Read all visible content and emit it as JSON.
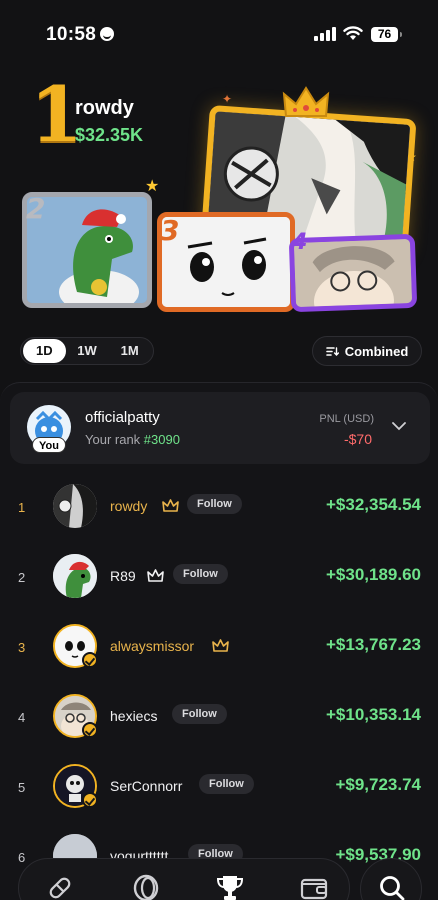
{
  "status_bar": {
    "time": "10:58",
    "battery": "76"
  },
  "hero": {
    "top_rank": "1",
    "top_name": "rowdy",
    "top_amount": "$32.35K",
    "podium": [
      "2",
      "3",
      "4"
    ]
  },
  "filters": {
    "periods": [
      "1D",
      "1W",
      "1M"
    ],
    "active_period": "1D",
    "combined_label": "Combined"
  },
  "you": {
    "name": "officialpatty",
    "rank_label": "Your rank",
    "rank_value": "#3090",
    "badge": "You",
    "pnl_label": "PNL (USD)",
    "pnl_value": "-$70"
  },
  "follow_label": "Follow",
  "leaderboard": [
    {
      "rank": "1",
      "name": "rowdy",
      "amount": "+$32,354.54"
    },
    {
      "rank": "2",
      "name": "R89",
      "amount": "+$30,189.60"
    },
    {
      "rank": "3",
      "name": "alwaysmissor",
      "amount": "+$13,767.23"
    },
    {
      "rank": "4",
      "name": "hexiecs",
      "amount": "+$10,353.14"
    },
    {
      "rank": "5",
      "name": "SerConnorr",
      "amount": "+$9,723.74"
    },
    {
      "rank": "6",
      "name": "yogurtttttt",
      "amount": "+$9,537.90"
    }
  ],
  "colors": {
    "gold": "#f2b322",
    "green": "#6fe38a",
    "red": "#ff6b6b",
    "bg": "#121214"
  },
  "nav_icons": [
    "pill-icon",
    "ring-icon",
    "trophy-icon",
    "wallet-icon",
    "search-icon"
  ]
}
